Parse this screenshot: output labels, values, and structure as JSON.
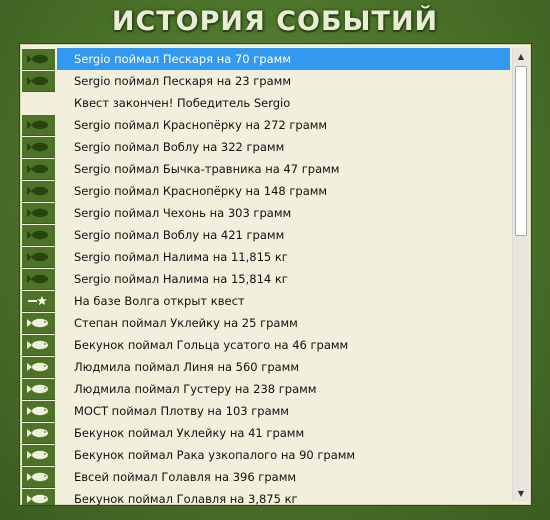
{
  "window": {
    "title": "ИСТОРИЯ СОБЫТИЙ"
  },
  "colors": {
    "accent_selected": "#3399f0",
    "panel_bg": "#f2efdc",
    "frame_green": "#4a7229"
  },
  "scrollbar": {
    "up_arrow": "▲",
    "down_arrow": "▼"
  },
  "events": [
    {
      "icon": "dark-fish-icon",
      "text": "Sergio поймал Пескаря на 70 грамм",
      "selected": true
    },
    {
      "icon": "dark-fish-icon",
      "text": "Sergio поймал Пескаря на 23 грамм"
    },
    {
      "icon": "none",
      "text": "Квест закончен! Победитель Sergio"
    },
    {
      "icon": "dark-fish-icon",
      "text": "Sergio поймал Краснопёрку на 272 грамм"
    },
    {
      "icon": "dark-fish-icon",
      "text": "Sergio поймал Воблу на 322 грамм"
    },
    {
      "icon": "dark-fish-icon",
      "text": "Sergio поймал Бычка-травника на 47 грамм"
    },
    {
      "icon": "dark-fish-icon",
      "text": "Sergio поймал Краснопёрку на 148 грамм"
    },
    {
      "icon": "dark-fish-icon",
      "text": "Sergio поймал Чехонь на 303 грамм"
    },
    {
      "icon": "dark-fish-icon",
      "text": "Sergio поймал Воблу на 421 грамм"
    },
    {
      "icon": "dark-fish-icon",
      "text": "Sergio поймал Налима на 11,815 кг"
    },
    {
      "icon": "dark-fish-icon",
      "text": "Sergio поймал Налима на 15,814 кг"
    },
    {
      "icon": "quest-flag-icon",
      "text": "На базе Волга открыт квест"
    },
    {
      "icon": "light-fish-icon",
      "text": "Степан поймал Уклейку на 25 грамм"
    },
    {
      "icon": "light-fish-icon",
      "text": "Бекунок поймал Гольца усатого на 46 грамм"
    },
    {
      "icon": "light-fish-icon",
      "text": "Людмила поймал Линя на 560 грамм"
    },
    {
      "icon": "light-fish-icon",
      "text": "Людмила поймал Густеру на 238 грамм"
    },
    {
      "icon": "light-fish-icon",
      "text": "МОСТ поймал Плотву на 103 грамм"
    },
    {
      "icon": "light-fish-icon",
      "text": "Бекунок поймал Уклейку на 41 грамм"
    },
    {
      "icon": "light-fish-icon",
      "text": "Бекунок поймал Рака узкопалого на 90 грамм"
    },
    {
      "icon": "light-fish-icon",
      "text": "Евсей поймал Голавля на 396 грамм"
    },
    {
      "icon": "light-fish-icon",
      "text": "Бекунок поймал Голавля на 3,875 кг"
    }
  ]
}
